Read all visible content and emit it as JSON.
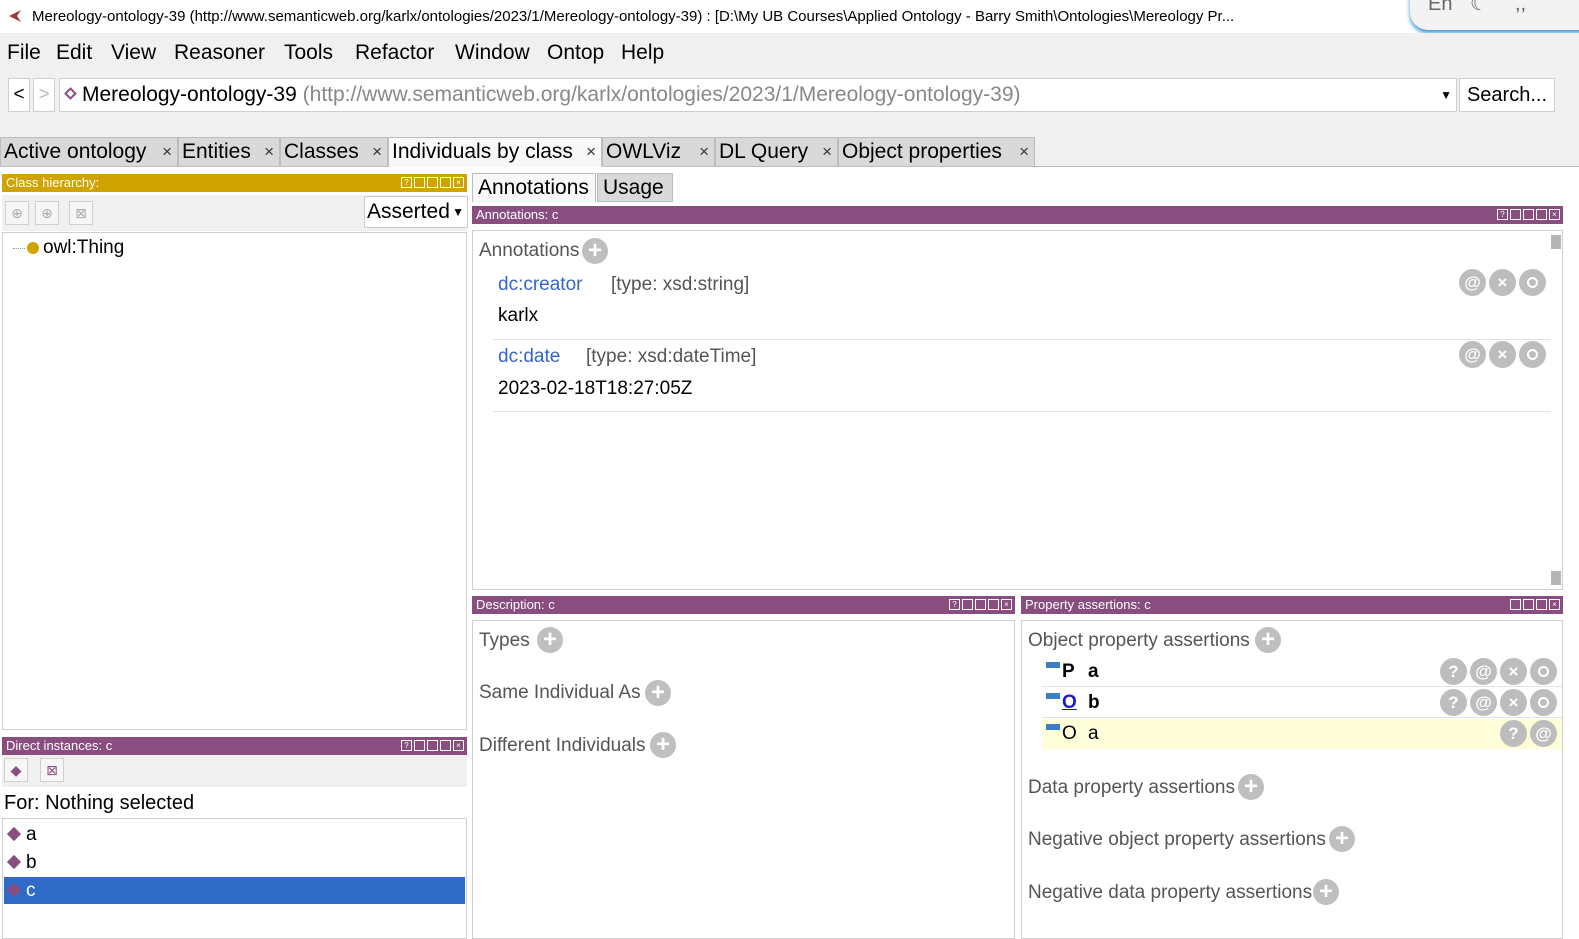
{
  "window": {
    "title": "Mereology-ontology-39 (http://www.semanticweb.org/karlx/ontologies/2023/1/Mereology-ontology-39)  : [D:\\My UB Courses\\Applied Ontology - Barry Smith\\Ontologies\\Mereology Pr...",
    "ime_text": "En"
  },
  "menu": [
    "File",
    "Edit",
    "View",
    "Reasoner",
    "Tools",
    "Refactor",
    "Window",
    "Ontop",
    "Help"
  ],
  "nav": {
    "back": "<",
    "forward": ">",
    "ontology_name": "Mereology-ontology-39",
    "ontology_iri": "(http://www.semanticweb.org/karlx/ontologies/2023/1/Mereology-ontology-39)",
    "search_label": "Search..."
  },
  "tabs": [
    "Active ontology",
    "Entities",
    "Classes",
    "Individuals by class",
    "OWLViz",
    "DL Query",
    "Object properties"
  ],
  "active_tab": "Individuals by class",
  "class_hierarchy": {
    "header": "Class hierarchy:",
    "mode": "Asserted",
    "root": "owl:Thing"
  },
  "direct_instances": {
    "header": "Direct instances: c",
    "for_label": "For: Nothing selected",
    "items": [
      "a",
      "b",
      "c"
    ],
    "selected": "c"
  },
  "annotations_panel": {
    "tabs": [
      "Annotations",
      "Usage"
    ],
    "header": "Annotations: c",
    "section_label": "Annotations",
    "entries": [
      {
        "property": "dc:creator",
        "type": "[type: xsd:string]",
        "value": "karlx"
      },
      {
        "property": "dc:date",
        "type": "[type: xsd:dateTime]",
        "value": "2023-02-18T18:27:05Z"
      }
    ]
  },
  "description_panel": {
    "header": "Description: c",
    "sections": [
      "Types",
      "Same Individual As",
      "Different Individuals"
    ]
  },
  "property_assertions": {
    "header": "Property assertions: c",
    "object_label": "Object property assertions",
    "object_rows": [
      {
        "prop": "P",
        "value": "a",
        "style": "bold"
      },
      {
        "prop": "O",
        "value": "b",
        "style": "link"
      },
      {
        "prop": "O",
        "value": "a",
        "style": "inferred"
      }
    ],
    "data_label": "Data property assertions",
    "neg_object_label": "Negative object property assertions",
    "neg_data_label": "Negative data property assertions"
  },
  "colors": {
    "purple_header": "#8a4d80",
    "yellow_header": "#d1a300",
    "selection": "#2f6bc6",
    "link": "#3366cc"
  }
}
